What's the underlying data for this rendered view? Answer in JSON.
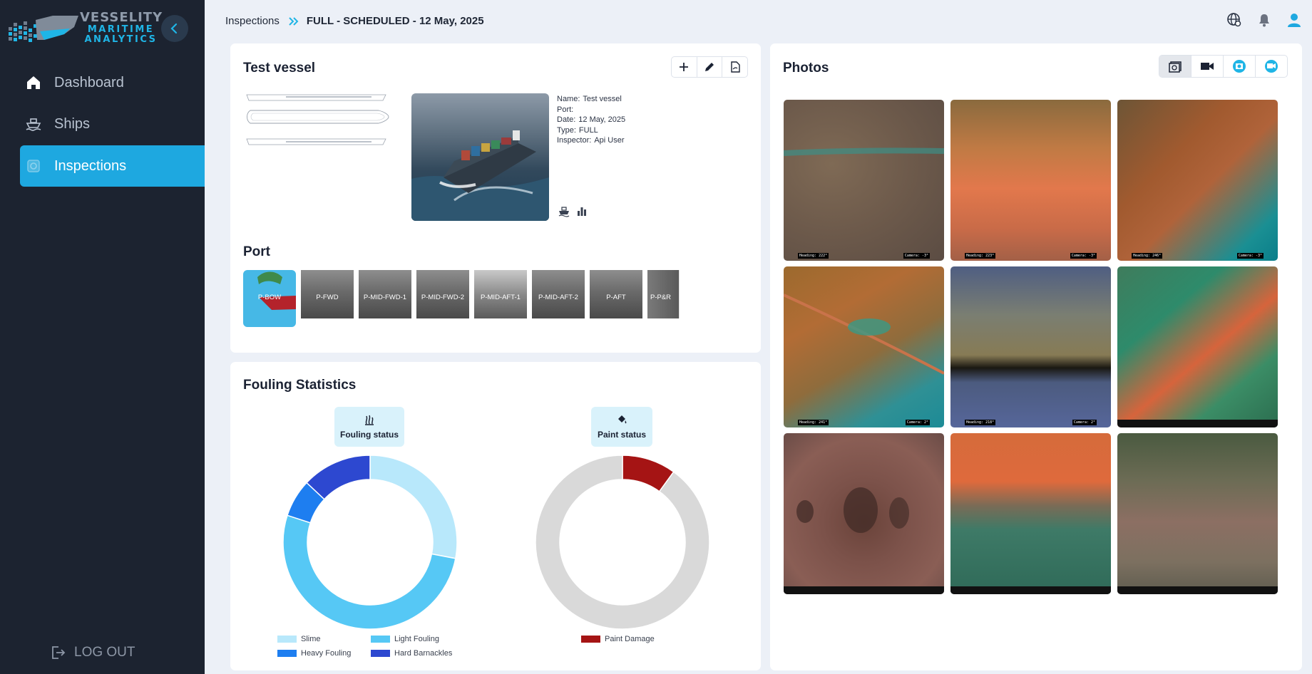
{
  "app": {
    "logo": {
      "line1": "VESSELITY",
      "line2": "MARITIME",
      "line3": "ANALYTICS"
    },
    "brand_color": "#1ea8e0",
    "sidebar_bg": "#1c2330"
  },
  "sidebar": {
    "items": [
      {
        "label": "Dashboard",
        "icon": "home-icon"
      },
      {
        "label": "Ships",
        "icon": "ship-icon"
      },
      {
        "label": "Inspections",
        "icon": "inspection-icon",
        "active": true
      }
    ],
    "logout_label": "LOG OUT"
  },
  "breadcrumb": {
    "parent": "Inspections",
    "current": "FULL - SCHEDULED - 12 May, 2025"
  },
  "vessel": {
    "title": "Test vessel",
    "info": [
      {
        "key": "Name:",
        "value": "Test vessel"
      },
      {
        "key": "Port:",
        "value": ""
      },
      {
        "key": "Date:",
        "value": "12 May, 2025"
      },
      {
        "key": "Type:",
        "value": "FULL"
      },
      {
        "key": "Inspector:",
        "value": "Api User"
      }
    ]
  },
  "port": {
    "title": "Port",
    "sections": [
      "P-BOW",
      "P-FWD",
      "P-MID-FWD-1",
      "P-MID-FWD-2",
      "P-MID-AFT-1",
      "P-MID-AFT-2",
      "P-AFT",
      "P-P&R"
    ]
  },
  "fouling": {
    "title": "Fouling Statistics",
    "fouling_status_label": "Fouling status",
    "paint_status_label": "Paint status",
    "legend_fouling": [
      {
        "label": "Slime",
        "color": "#b8e8fb"
      },
      {
        "label": "Light Fouling",
        "color": "#56c8f5"
      },
      {
        "label": "Heavy Fouling",
        "color": "#1e7ef0"
      },
      {
        "label": "Hard Barnackles",
        "color": "#2d48d0"
      }
    ],
    "legend_paint": [
      {
        "label": "Paint Damage",
        "color": "#a51414"
      }
    ]
  },
  "chart_data": [
    {
      "type": "pie",
      "title": "Fouling status",
      "categories": [
        "Slime",
        "Light Fouling",
        "Heavy Fouling",
        "Hard Barnackles"
      ],
      "values": [
        28,
        52,
        7,
        13
      ],
      "colors": [
        "#b8e8fb",
        "#56c8f5",
        "#1e7ef0",
        "#2d48d0"
      ]
    },
    {
      "type": "pie",
      "title": "Paint status",
      "categories": [
        "Paint Damage",
        "Other"
      ],
      "values": [
        10,
        90
      ],
      "colors": [
        "#a51414",
        "#d9d9d9"
      ]
    }
  ],
  "photos": {
    "title": "Photos",
    "items": [
      {
        "left": "Heading: 222°",
        "right": "Camera: -3°"
      },
      {
        "left": "Heading: 223°",
        "right": "Camera: -3°"
      },
      {
        "left": "Heading: 246°",
        "right": "Camera: -3°"
      },
      {
        "left": "Heading: 241°",
        "right": "Camera: 2°"
      },
      {
        "left": "Heading: 218°",
        "right": "Camera: 2°"
      },
      {
        "left": "",
        "right": ""
      },
      {
        "left": "",
        "right": ""
      },
      {
        "left": "",
        "right": ""
      },
      {
        "left": "",
        "right": ""
      }
    ]
  }
}
